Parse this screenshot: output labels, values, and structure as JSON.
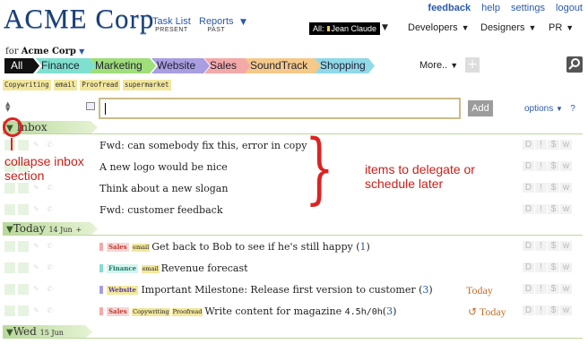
{
  "header": {
    "logo": "ACME Corp",
    "nav": [
      {
        "label": "Task List",
        "sub": "PRESENT"
      },
      {
        "label": "Reports",
        "sub": "PAST"
      }
    ],
    "toplinks": {
      "feedback": "feedback",
      "help": "help",
      "settings": "settings",
      "logout": "logout"
    },
    "user_prefix": "All:",
    "user": "Jean Claude",
    "menus": [
      "Developers",
      "Designers",
      "PR"
    ],
    "caret": "▼"
  },
  "for_line": {
    "prefix": "for",
    "org": "Acme Corp"
  },
  "tabs": [
    {
      "label": "All",
      "color": "#111111",
      "text": "#ffffff"
    },
    {
      "label": "Finance",
      "color": "#7fe0cf"
    },
    {
      "label": "Marketing",
      "color": "#9fde7a"
    },
    {
      "label": "Website",
      "color": "#a99ee0"
    },
    {
      "label": "Sales",
      "color": "#f4a9a9"
    },
    {
      "label": "SoundTrack",
      "color": "#f5c98a"
    },
    {
      "label": "Shopping",
      "color": "#8fd9e9"
    }
  ],
  "more_label": "More..",
  "tags": [
    "Copywriting",
    "email",
    "Proofread",
    "supermarket"
  ],
  "add_button": "Add",
  "options_label": "options",
  "help_mark": "?",
  "sections": {
    "inbox": {
      "label": "Inbox"
    },
    "today": {
      "label": "Today",
      "date": "14 Jun",
      "plus": "+"
    },
    "wed": {
      "label": "Wed",
      "date": "15 Jun"
    }
  },
  "inbox_items": [
    "Fwd: can somebody fix this, error in copy",
    "A new logo would be nice",
    "Think about a new slogan",
    "Fwd: customer feedback"
  ],
  "today_items": [
    {
      "project": "Sales",
      "tags": [
        "email"
      ],
      "text": "Get back to Bob to see if he's still happy",
      "count": "1",
      "swatch": "#f4a9a9",
      "pcolor": "#c0392b"
    },
    {
      "project": "Finance",
      "tags": [
        "email"
      ],
      "text": "Revenue forecast",
      "swatch": "#7fe0cf",
      "pcolor": "#1a7a6a"
    },
    {
      "project": "Website",
      "tags": [],
      "text": "Important Milestone: Release first version to customer",
      "count": "3",
      "due": "Today",
      "swatch": "#a99ee0",
      "pcolor": "#5a3a9a"
    },
    {
      "project": "Sales",
      "tags": [
        "Copywriting",
        "Proofread"
      ],
      "text": "Write content for magazine",
      "duration": "4.5h/0h",
      "count": "3",
      "due": "↺ Today",
      "swatch": "#f4a9a9",
      "pcolor": "#c0392b"
    }
  ],
  "action_letters": [
    "D",
    "!",
    "$",
    "w"
  ],
  "annotations": {
    "collapse": "collapse inbox section",
    "delegate": "items to delegate or schedule later"
  },
  "colors": {
    "accent": "#2a5aa8",
    "annotation": "#d22222",
    "section": "#b9d99a"
  }
}
